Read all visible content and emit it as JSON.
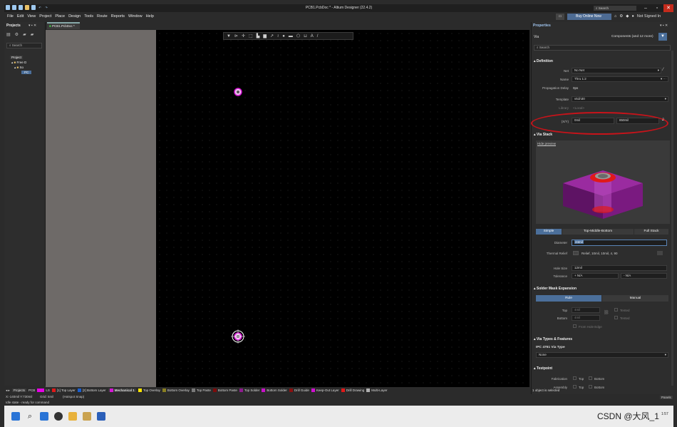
{
  "window": {
    "title": "PCB1.PcbDoc * - Altium Designer (22.4.2)",
    "search": "Search"
  },
  "menu": [
    "File",
    "Edit",
    "View",
    "Project",
    "Place",
    "Design",
    "Tools",
    "Route",
    "Reports",
    "Window",
    "Help"
  ],
  "menu_right": {
    "buy": "Buy Online Now",
    "signed": "Not Signed In"
  },
  "projects_panel": {
    "title": "Projects",
    "search_placeholder": "Search",
    "tree": [
      "Project",
      "Free D",
      "So",
      "PC"
    ]
  },
  "doc_tab": "PCB1.PcbDoc *",
  "properties": {
    "title": "Properties",
    "object": "Via",
    "filter": "Components (and 12 more)",
    "search_placeholder": "Search",
    "definition": {
      "section": "Definition",
      "net_label": "Net",
      "net_value": "No Net",
      "name_label": "Name",
      "name_value": "Thru 1:2",
      "prop_delay_label": "Propagation Delay",
      "prop_delay_value": "0ps",
      "template_label": "Template",
      "template_value": "v51h30",
      "library_label": "Library",
      "library_value": "<Local>",
      "xy_label": "(X/Y)",
      "x_value": "0mil",
      "y_value": "850mil"
    },
    "via_stack": {
      "section": "Via Stack",
      "hide_preview": "Hide preview",
      "modes": [
        "Simple",
        "Top-Middle-Bottom",
        "Full Stack"
      ],
      "selected_mode": "Simple",
      "diameter_label": "Diameter",
      "diameter_value": "24mil",
      "thermal_label": "Thermal Relief",
      "thermal_value": "Relief, 10mil, 10mil, 4, 90",
      "hole_size_label": "Hole Size",
      "hole_size_value": "12mil",
      "tolerance_label": "Tolerance",
      "tol_plus": "N/A",
      "tol_minus": "N/A"
    },
    "solder_mask": {
      "section": "Solder Mask Expansion",
      "modes": [
        "Rule",
        "Manual"
      ],
      "selected_mode": "Rule",
      "top_label": "Top",
      "top_value": "4mil",
      "top_tented": "Tented",
      "bottom_label": "Bottom",
      "bottom_value": "4mil",
      "bottom_tented": "Tented",
      "from_hole": "From Hole Edge"
    },
    "via_types": {
      "section": "Via Types & Features",
      "ipc_label": "IPC 4761 Via Type",
      "ipc_value": "None"
    },
    "testpoint": {
      "section": "Testpoint",
      "fab_label": "Fabrication",
      "asm_label": "Assembly",
      "top": "Top",
      "bottom": "Bottom"
    },
    "selected_count": "1 object is selected"
  },
  "layers": [
    {
      "name": "LS",
      "color": "#e600e6"
    },
    {
      "name": "[1] Top Layer",
      "color": "#e01919"
    },
    {
      "name": "[2] Bottom Layer",
      "color": "#1a5fd0"
    },
    {
      "name": "Mechanical 1",
      "color": "#d418d4",
      "active": true
    },
    {
      "name": "Top Overlay",
      "color": "#ffe600"
    },
    {
      "name": "Bottom Overlay",
      "color": "#8a7f22"
    },
    {
      "name": "Top Paste",
      "color": "#7a7a7a"
    },
    {
      "name": "Bottom Paste",
      "color": "#7d0b0b"
    },
    {
      "name": "Top Solder",
      "color": "#8e1c8e"
    },
    {
      "name": "Bottom Solder",
      "color": "#c812c8"
    },
    {
      "name": "Drill Guide",
      "color": "#8a1010"
    },
    {
      "name": "Keep-Out Layer",
      "color": "#d010d0"
    },
    {
      "name": "Drill Drawing",
      "color": "#e01919"
    },
    {
      "name": "Multi-Layer",
      "color": "#b0b0b0"
    }
  ],
  "bottom_tabs": {
    "projects": "Projects",
    "pcb": "PCB"
  },
  "status": {
    "coords": "X:-140mil Y:730mil",
    "grid": "Grid: 5mil",
    "snap": "(Hotspot Snap)",
    "state": "Idle state - ready for command",
    "panels": "Panels"
  },
  "watermark": "CSDN @大风_1",
  "clock": "1:57"
}
